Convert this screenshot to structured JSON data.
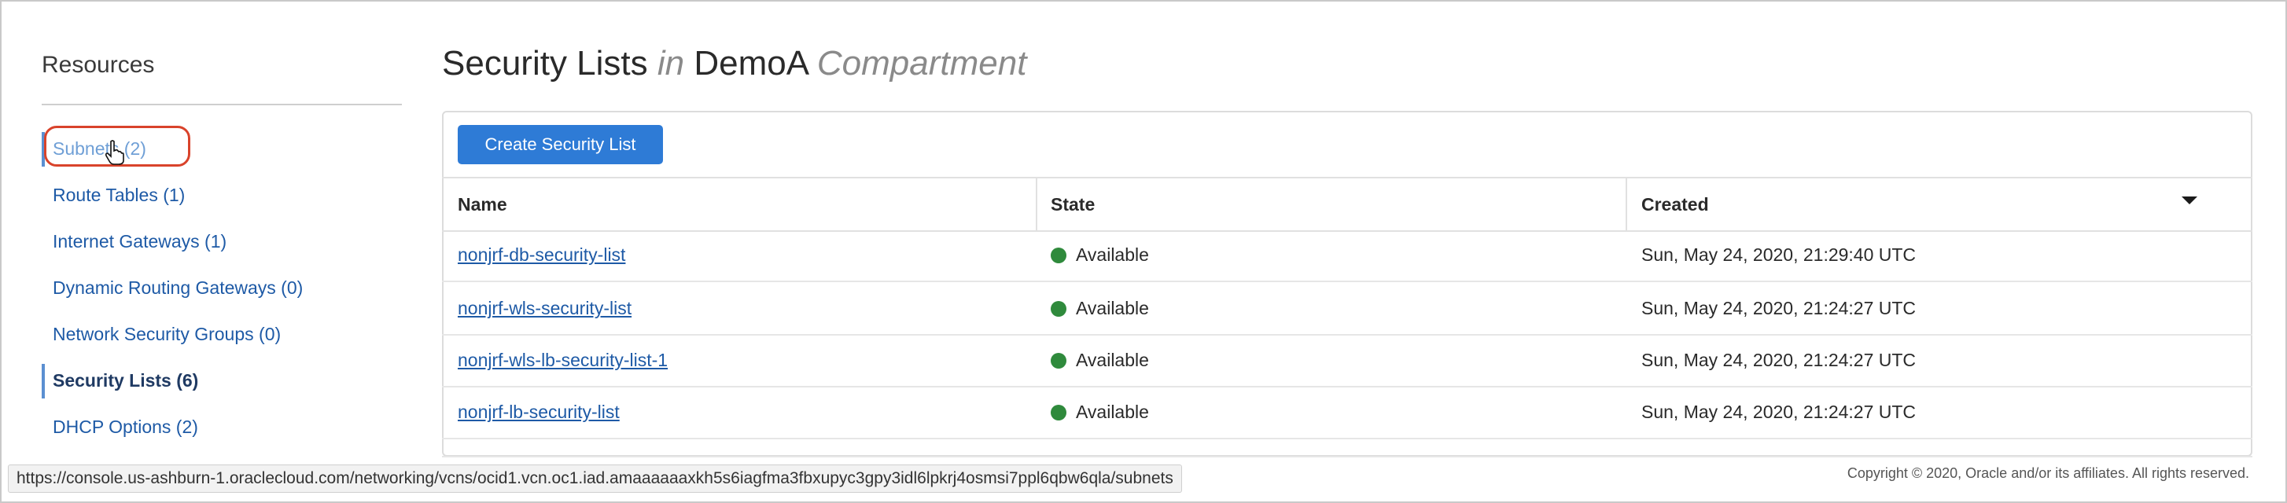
{
  "sidebar": {
    "title": "Resources",
    "items": [
      {
        "label": "Subnets (2)"
      },
      {
        "label": "Route Tables (1)"
      },
      {
        "label": "Internet Gateways (1)"
      },
      {
        "label": "Dynamic Routing Gateways (0)"
      },
      {
        "label": "Network Security Groups (0)"
      },
      {
        "label": "Security Lists (6)",
        "active": true
      },
      {
        "label": "DHCP Options (2)"
      }
    ]
  },
  "header": {
    "title_main": "Security Lists",
    "title_in": "in",
    "compartment_name": "DemoA",
    "compartment_word": "Compartment"
  },
  "toolbar": {
    "create_label": "Create Security List"
  },
  "table": {
    "columns": [
      "Name",
      "State",
      "Created"
    ],
    "rows": [
      {
        "name": "nonjrf-db-security-list",
        "state": "Available",
        "created": "Sun, May 24, 2020, 21:29:40 UTC"
      },
      {
        "name": "nonjrf-wls-security-list",
        "state": "Available",
        "created": "Sun, May 24, 2020, 21:24:27 UTC"
      },
      {
        "name": "nonjrf-wls-lb-security-list-1",
        "state": "Available",
        "created": "Sun, May 24, 2020, 21:24:27 UTC"
      },
      {
        "name": "nonjrf-lb-security-list",
        "state": "Available",
        "created": "Sun, May 24, 2020, 21:24:27 UTC"
      }
    ]
  },
  "status_bar": {
    "url": "https://console.us-ashburn-1.oraclecloud.com/networking/vcns/ocid1.vcn.oc1.iad.amaaaaaaxkh5s6iagfma3fbxupyc3gpy3idl6lpkrj4osmsi7ppl6qbw6qla/subnets"
  },
  "footer": {
    "copyright": "Copyright © 2020, Oracle and/or its affiliates. All rights reserved."
  },
  "colors": {
    "accent": "#2e7bd6",
    "link": "#1e5aa6",
    "available": "#2f8a3c",
    "highlight": "#d9432b"
  }
}
